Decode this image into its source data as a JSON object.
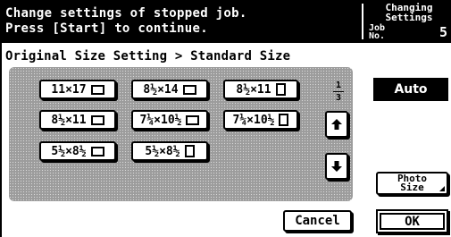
{
  "header": {
    "message_line1": "Change settings of stopped job.",
    "message_line2": "Press [Start] to continue.",
    "status_title_line1": "Changing",
    "status_title_line2": "Settings",
    "job_label_line1": "Job",
    "job_label_line2": "No.",
    "job_number": "5"
  },
  "breadcrumb": "Original Size Setting > Standard Size",
  "sizes": [
    {
      "label": "11×17",
      "orientation": "landscape"
    },
    {
      "label": "8½×14",
      "orientation": "landscape"
    },
    {
      "label": "8½×11",
      "orientation": "portrait"
    },
    {
      "label": "8½×11",
      "orientation": "landscape"
    },
    {
      "label": "7¼×10½",
      "orientation": "landscape"
    },
    {
      "label": "7¼×10½",
      "orientation": "portrait"
    },
    {
      "label": "5½×8½",
      "orientation": "landscape"
    },
    {
      "label": "5½×8½",
      "orientation": "portrait"
    }
  ],
  "pager": {
    "current": "1",
    "total": "3"
  },
  "buttons": {
    "auto": "Auto",
    "photo_line1": "Photo",
    "photo_line2": "Size",
    "cancel": "Cancel",
    "ok": "OK"
  },
  "icons": {
    "scroll_up": "up-arrow-icon",
    "scroll_down": "down-arrow-icon"
  }
}
